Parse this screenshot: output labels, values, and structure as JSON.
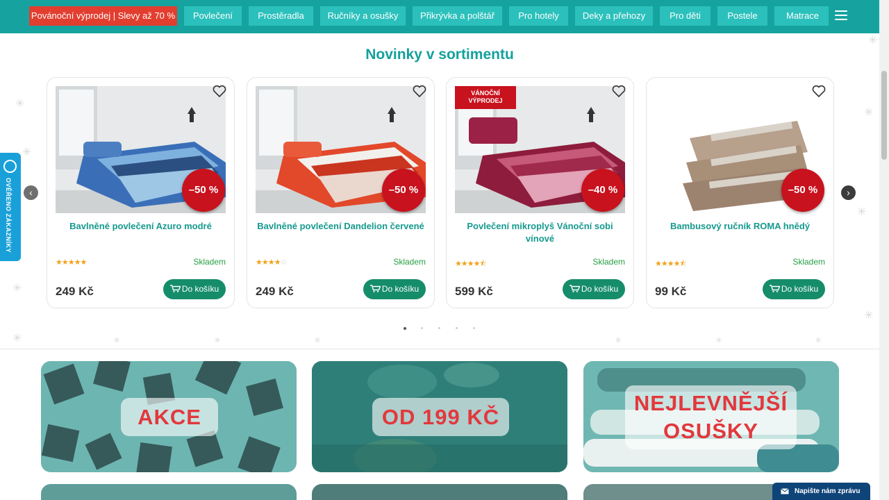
{
  "nav": {
    "sale_label": "Povánoční výprodej | Slevy až 70 %",
    "items": [
      "Povlečení",
      "Prostěradla",
      "Ručníky a osušky",
      "Přikrývka a polštář",
      "Pro hotely",
      "Deky a přehozy",
      "Pro děti",
      "Postele",
      "Matrace"
    ]
  },
  "section": {
    "title": "Novinky v sortimentu"
  },
  "products": [
    {
      "name": "Bavlněné povlečení Azuro modré",
      "discount": "–50 %",
      "rating": 5,
      "stock": "Skladem",
      "price": "249 Kč",
      "cart": "Do košíku",
      "ribbon": ""
    },
    {
      "name": "Bavlněné povlečení Dandelion červené",
      "discount": "–50 %",
      "rating": 4,
      "stock": "Skladem",
      "price": "249 Kč",
      "cart": "Do košíku",
      "ribbon": ""
    },
    {
      "name": "Povlečení mikroplyš Vánoční sobi vínové",
      "discount": "–40 %",
      "rating": 4.5,
      "stock": "Skladem",
      "price": "599 Kč",
      "cart": "Do košíku",
      "ribbon": "VÁNOČNÍ\nVÝPRODEJ"
    },
    {
      "name": "Bambusový ručník ROMA hnědý",
      "discount": "–50 %",
      "rating": 4.5,
      "stock": "Skladem",
      "price": "99 Kč",
      "cart": "Do košíku",
      "ribbon": ""
    }
  ],
  "carousel": {
    "pages": 5,
    "active": 1
  },
  "side_badge": {
    "label": "OVĚŘENO ZÁKAZNÍKY"
  },
  "banners": [
    {
      "label": "AKCE"
    },
    {
      "label": "OD 199 KČ"
    },
    {
      "label": "NEJLEVNĚJŠÍ OSUŠKY"
    }
  ],
  "chat": {
    "label": "Napište nám zprávu"
  },
  "colors": {
    "primary": "#16a3a0",
    "nav_button": "#2bc0bb",
    "sale": "#e23e2f",
    "cart": "#158c6a",
    "discount": "#c8121e",
    "chat": "#0f4479"
  }
}
